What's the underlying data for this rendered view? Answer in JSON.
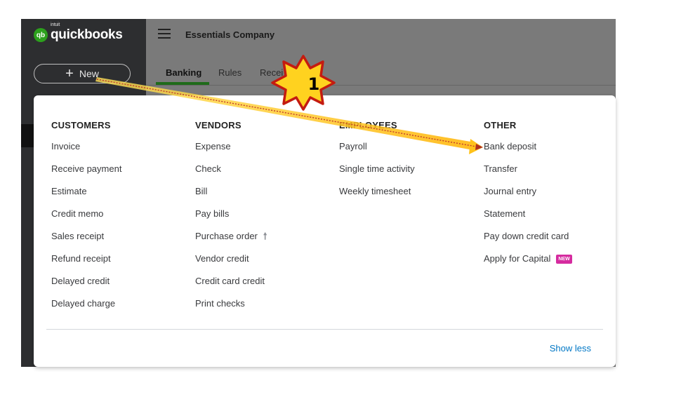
{
  "app": {
    "logo": {
      "mark": "qb",
      "brand_small": "intuit",
      "brand": "quickbooks"
    },
    "new_button": {
      "icon": "plus-icon",
      "label": "New"
    },
    "company_name": "Essentials Company",
    "tabs": [
      {
        "label": "Banking",
        "active": true
      },
      {
        "label": "Rules",
        "active": false
      },
      {
        "label": "Recei",
        "active": false
      }
    ]
  },
  "menu": {
    "columns": [
      {
        "heading": "CUSTOMERS",
        "items": [
          "Invoice",
          "Receive payment",
          "Estimate",
          "Credit memo",
          "Sales receipt",
          "Refund receipt",
          "Delayed credit",
          "Delayed charge"
        ]
      },
      {
        "heading": "VENDORS",
        "items": [
          "Expense",
          "Check",
          "Bill",
          "Pay bills",
          "Purchase order",
          "Vendor credit",
          "Credit card credit",
          "Print checks"
        ]
      },
      {
        "heading": "EMPLOYEES",
        "items": [
          "Payroll",
          "Single time activity",
          "Weekly timesheet"
        ]
      },
      {
        "heading": "OTHER",
        "items": [
          "Bank deposit",
          "Transfer",
          "Journal entry",
          "Statement",
          "Pay down credit card",
          "Apply for Capital"
        ]
      }
    ],
    "purchase_order_icon": "arrow-up-icon",
    "capital_badge": "NEW",
    "show_less": "Show less"
  },
  "annotation": {
    "step_number": "1",
    "color": "#ffd21f"
  },
  "colors": {
    "sidebar": "#2d2e30",
    "accent_green": "#2ca01c",
    "link_blue": "#0077c5",
    "badge_pink": "#d52b9f"
  }
}
